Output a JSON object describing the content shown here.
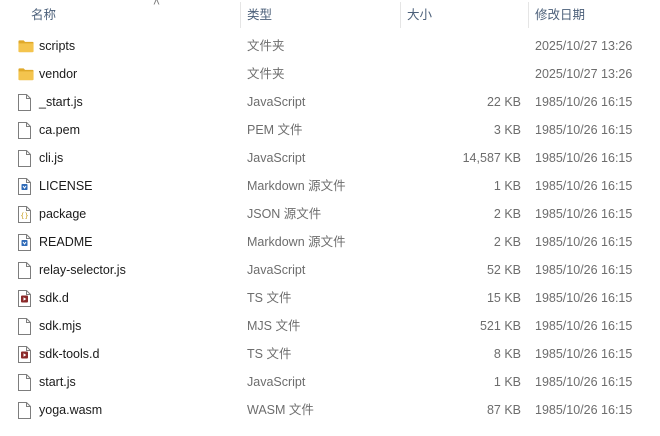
{
  "columns": {
    "name": "名称",
    "type": "类型",
    "size": "大小",
    "date": "修改日期"
  },
  "sort_indicator": "˄",
  "files": [
    {
      "name": "scripts",
      "type": "文件夹",
      "size": "",
      "date": "2025/10/27 13:26",
      "icon": "folder-icon"
    },
    {
      "name": "vendor",
      "type": "文件夹",
      "size": "",
      "date": "2025/10/27 13:26",
      "icon": "folder-icon"
    },
    {
      "name": "_start.js",
      "type": "JavaScript",
      "size": "22 KB",
      "date": "1985/10/26 16:15",
      "icon": "document-icon"
    },
    {
      "name": "ca.pem",
      "type": "PEM 文件",
      "size": "3 KB",
      "date": "1985/10/26 16:15",
      "icon": "document-icon"
    },
    {
      "name": "cli.js",
      "type": "JavaScript",
      "size": "14,587 KB",
      "date": "1985/10/26 16:15",
      "icon": "document-icon"
    },
    {
      "name": "LICENSE",
      "type": "Markdown 源文件",
      "size": "1 KB",
      "date": "1985/10/26 16:15",
      "icon": "markdown-file-icon"
    },
    {
      "name": "package",
      "type": "JSON 源文件",
      "size": "2 KB",
      "date": "1985/10/26 16:15",
      "icon": "json-file-icon"
    },
    {
      "name": "README",
      "type": "Markdown 源文件",
      "size": "2 KB",
      "date": "1985/10/26 16:15",
      "icon": "markdown-file-icon"
    },
    {
      "name": "relay-selector.js",
      "type": "JavaScript",
      "size": "52 KB",
      "date": "1985/10/26 16:15",
      "icon": "document-icon"
    },
    {
      "name": "sdk.d",
      "type": "TS 文件",
      "size": "15 KB",
      "date": "1985/10/26 16:15",
      "icon": "ts-video-file-icon"
    },
    {
      "name": "sdk.mjs",
      "type": "MJS 文件",
      "size": "521 KB",
      "date": "1985/10/26 16:15",
      "icon": "document-icon"
    },
    {
      "name": "sdk-tools.d",
      "type": "TS 文件",
      "size": "8 KB",
      "date": "1985/10/26 16:15",
      "icon": "ts-video-file-icon"
    },
    {
      "name": "start.js",
      "type": "JavaScript",
      "size": "1 KB",
      "date": "1985/10/26 16:15",
      "icon": "document-icon"
    },
    {
      "name": "yoga.wasm",
      "type": "WASM 文件",
      "size": "87 KB",
      "date": "1985/10/26 16:15",
      "icon": "document-icon"
    }
  ],
  "colors": {
    "header_text": "#4c607a",
    "secondary_text": "#6d6d6d",
    "folder": "#f4c44e",
    "folder_dark": "#e0a92a",
    "markdown_badge": "#2f6bb8",
    "json_badge": "#c9a227",
    "ts_badge": "#8b2a2a"
  }
}
